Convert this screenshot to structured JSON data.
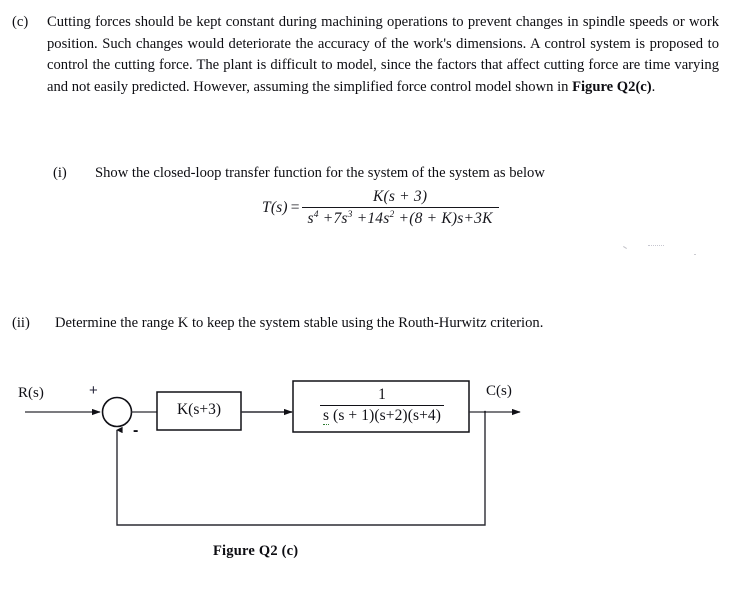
{
  "document": {
    "part_c": {
      "marker": "(c)",
      "body": "Cutting forces should be kept constant during machining operations to prevent changes in spindle speeds or work position. Such changes would deteriorate the accuracy of the work's dimensions. A control system is proposed to control the cutting force. The plant is difficult to model, since the factors that affect cutting force are time varying and not easily predicted. However, assuming the simplified force control model shown in ",
      "body_bold_tail": "Figure Q2(c)",
      "body_end": "."
    },
    "part_i": {
      "marker": "(i)",
      "body": "Show the closed-loop transfer function for the system of the system as below"
    },
    "part_ii": {
      "marker": "(ii)",
      "body": "Determine the range K to keep the system stable using the Routh-Hurwitz criterion."
    }
  },
  "equation": {
    "lhs": "T(s)",
    "equals": "=",
    "numerator": "K(s + 3)",
    "denominator_parts": {
      "t1_base": "s",
      "t1_exp": "4",
      "op1": "+",
      "t2_base": "7s",
      "t2_exp": "3",
      "op2": "+",
      "t3_base": "14s",
      "t3_exp": "2",
      "op3": "+",
      "t4": "(8 + K)s",
      "op4": "+",
      "t5": "3K"
    },
    "denominator_plain": "s4 + 7s3 + 14s2 + (8 + K)s + 3K"
  },
  "diagram": {
    "input_label": "R(s)",
    "output_label": "C(s)",
    "sum_plus": "+",
    "sum_minus": "-",
    "controller_block": "K(s+3)",
    "plant_numerator": "1",
    "plant_denominator_s": "s",
    "plant_denominator_rest": " (s + 1)(s+2)(s+4)",
    "plant_denominator_full": "s (s + 1)(s+2)(s+4)",
    "caption": "Figure Q2 (c)"
  },
  "colors": {
    "ink": "#0d0d12",
    "paper": "#ffffff",
    "spellcheck_underline": "#2f7d32",
    "sign_blue": "#24243a"
  }
}
